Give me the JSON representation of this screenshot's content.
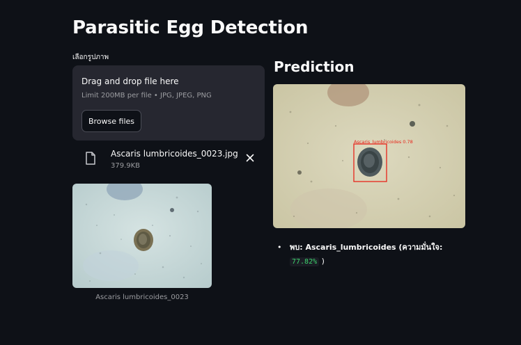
{
  "app": {
    "title": "Parasitic Egg Detection"
  },
  "uploader": {
    "label": "เลือกรูปภาพ",
    "drop_text": "Drag and drop file here",
    "limit_text": "Limit 200MB per file • JPG, JPEG, PNG",
    "browse_label": "Browse files"
  },
  "uploaded_file": {
    "name": "Ascaris lumbricoides_0023.jpg",
    "size": "379.9KB",
    "icon": "file-icon",
    "remove_icon": "close-icon"
  },
  "preview": {
    "caption": "Ascaris lumbricoides_0023"
  },
  "prediction": {
    "heading": "Prediction",
    "box_label": "Ascaris_lumbricoides 0.78",
    "box_color": "#e8241a",
    "result_prefix": "พบ: Ascaris_lumbricoides (ความมั่นใจ:",
    "confidence": "77.82%",
    "result_suffix": ")"
  },
  "colors": {
    "background": "#0e1117",
    "panel": "#262730",
    "confidence_text": "#3dd56d"
  }
}
